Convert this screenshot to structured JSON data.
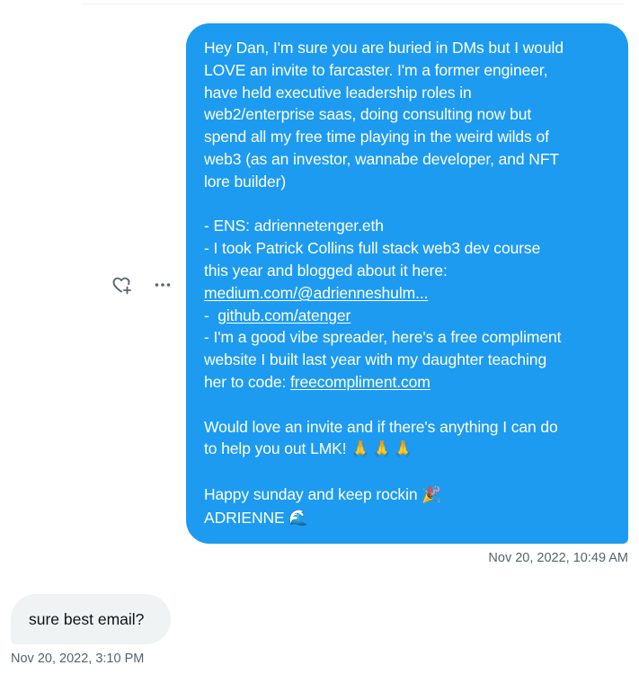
{
  "conversation": {
    "sent_message": {
      "lines": [
        "Hey Dan, I'm sure you are buried in DMs but I would",
        "LOVE an invite to farcaster.  I'm a former engineer,",
        "have held executive leadership roles in",
        "web2/enterprise saas, doing consulting now but",
        "spend all my free time playing in the weird wilds of",
        "web3 (as an investor, wannabe developer, and NFT",
        "lore builder)",
        "",
        "- ENS: adriennetenger.eth",
        "- I took Patrick Collins full stack web3 dev course",
        "this year and blogged about it here:"
      ],
      "medium_link": "medium.com/@adrienneshulm...",
      "github_prefix": "-  ",
      "github_link": "github.com/atenger",
      "compliment_lines": [
        "- I'm a good vibe spreader, here's a free compliment",
        "website I built last year with my daughter teaching"
      ],
      "compliment_prefix": "her to code: ",
      "compliment_link": "freecompliment.com",
      "closing_lines": [
        "Would love an invite and if there's anything I can do"
      ],
      "help_text": "to help you out LMK! ",
      "pray_emojis": "🙏🙏🙏",
      "sunday_text": "Happy sunday and keep rockin ",
      "party_emoji": "🎉",
      "signature": "ADRIENNE ",
      "wave_emoji": "🌊",
      "timestamp": "Nov 20, 2022, 10:49 AM"
    },
    "received_message": {
      "text": "sure best email?",
      "timestamp": "Nov 20, 2022, 3:10 PM"
    },
    "actions": {
      "react_icon": "heart-plus-icon",
      "more_icon": "more-horizontal-icon"
    },
    "colors": {
      "sent_bubble": "#1d9bf0",
      "received_bubble": "#eff3f4",
      "timestamp": "#536471",
      "icon": "#536471"
    }
  }
}
